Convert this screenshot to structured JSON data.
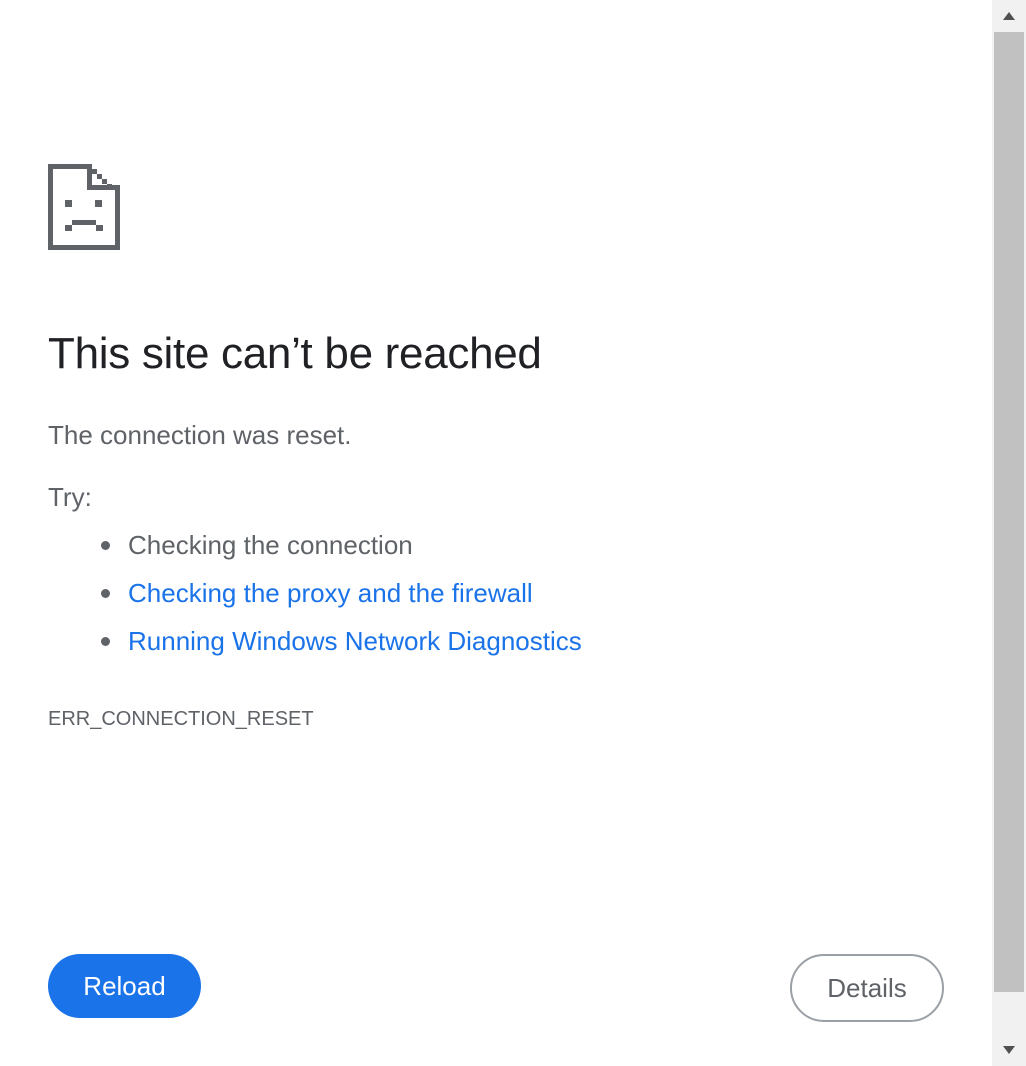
{
  "error_page": {
    "icon": "sad-document-icon",
    "heading": "This site can’t be reached",
    "summary": "The connection was reset.",
    "try_label": "Try:",
    "suggestions": [
      {
        "text": "Checking the connection",
        "is_link": false
      },
      {
        "text": "Checking the proxy and the firewall",
        "is_link": true
      },
      {
        "text": "Running Windows Network Diagnostics",
        "is_link": true
      }
    ],
    "error_code": "ERR_CONNECTION_RESET",
    "reload_label": "Reload",
    "details_label": "Details"
  },
  "colors": {
    "heading": "#202124",
    "body_text": "#5f6368",
    "link": "#1a73e8",
    "primary_button": "#1a73e8",
    "secondary_button_border": "#9aa0a6",
    "icon": "#5f6368"
  },
  "scrollbar": {
    "up_icon": "triangle-up-icon",
    "down_icon": "triangle-down-icon"
  }
}
